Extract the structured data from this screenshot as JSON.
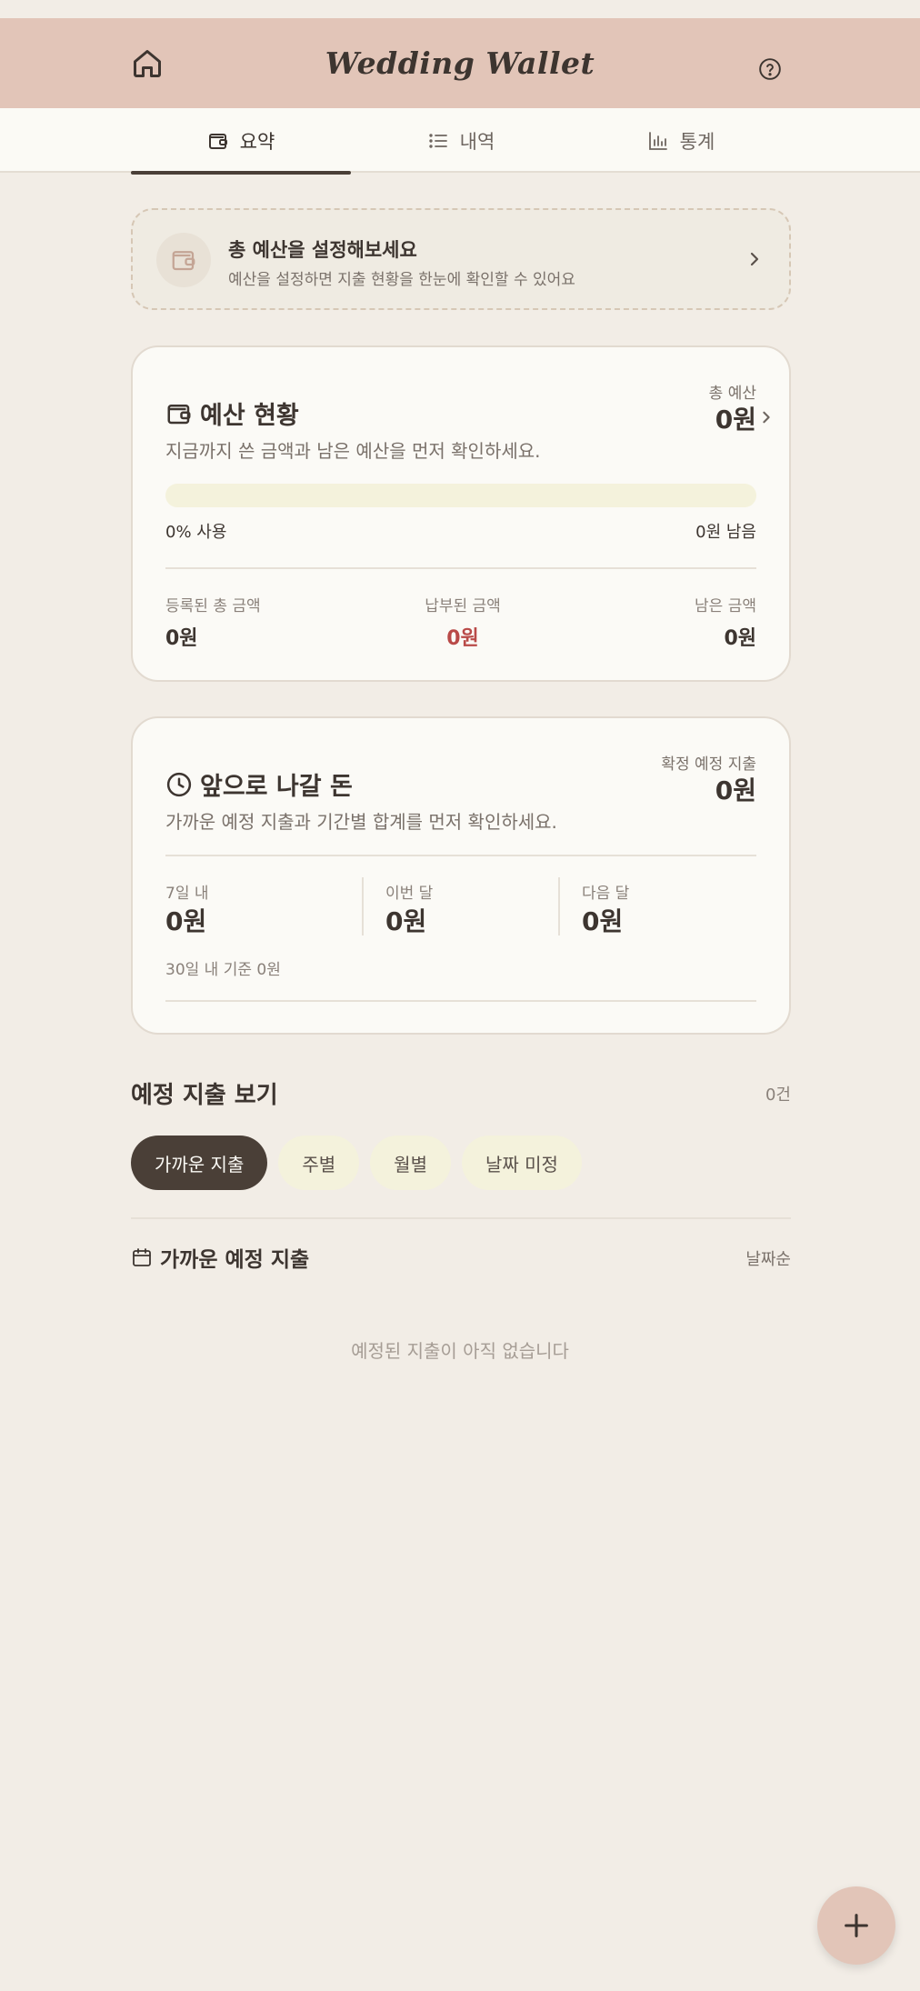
{
  "header": {
    "title": "Wedding Wallet"
  },
  "tabs": [
    {
      "label": "요약",
      "icon": "wallet-icon",
      "active": true
    },
    {
      "label": "내역",
      "icon": "list-icon",
      "active": false
    },
    {
      "label": "통계",
      "icon": "bar-chart-icon",
      "active": false
    }
  ],
  "banner": {
    "title": "총 예산을 설정해보세요",
    "subtitle": "예산을 설정하면 지출 현황을 한눈에 확인할 수 있어요"
  },
  "budget": {
    "title": "예산 현황",
    "subtitle": "지금까지 쓴 금액과 남은 예산을 먼저 확인하세요.",
    "total_label": "총 예산",
    "total_value": "0원",
    "progress": 0,
    "used_text": "0% 사용",
    "remaining_text": "0원 남음",
    "stats": [
      {
        "label": "등록된 총 금액",
        "value": "0원"
      },
      {
        "label": "납부된 금액",
        "value": "0원"
      },
      {
        "label": "남은 금액",
        "value": "0원"
      }
    ]
  },
  "upcoming": {
    "title": "앞으로 나갈 돈",
    "subtitle": "가까운 예정 지출과 기간별 합계를 먼저 확인하세요.",
    "confirmed_label": "확정 예정 지출",
    "confirmed_value": "0원",
    "periods": [
      {
        "label": "7일 내",
        "value": "0원"
      },
      {
        "label": "이번 달",
        "value": "0원"
      },
      {
        "label": "다음 달",
        "value": "0원"
      }
    ],
    "note": "30일 내 기준 0원"
  },
  "schedule": {
    "title": "예정 지출 보기",
    "count": "0건",
    "chips": [
      "가까운 지출",
      "주별",
      "월별",
      "날짜 미정"
    ],
    "list_title": "가까운 예정 지출",
    "sort": "날짜순",
    "empty": "예정된 지출이 아직 없습니다"
  },
  "colors": {
    "header_bg": "#e2c5b8",
    "background": "#f2ede6",
    "text": "#3d3530",
    "accent_red": "#b94a48"
  }
}
